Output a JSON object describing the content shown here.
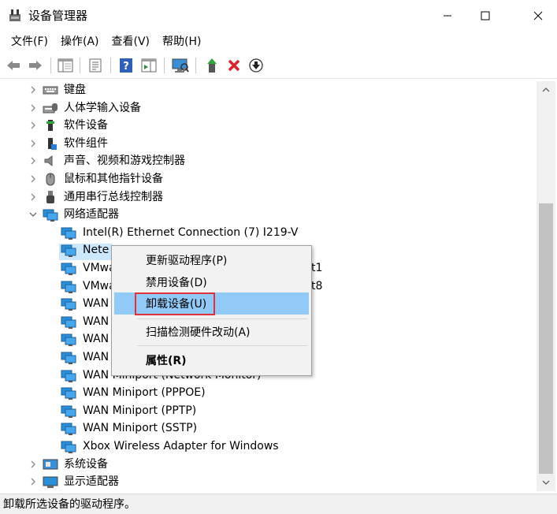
{
  "window": {
    "title": "设备管理器"
  },
  "menu": [
    "文件(F)",
    "操作(A)",
    "查看(V)",
    "帮助(H)"
  ],
  "tree": {
    "categories_top": [
      {
        "label": "键盘",
        "icon": "keyboard-icon"
      },
      {
        "label": "人体学输入设备",
        "icon": "hid-icon"
      },
      {
        "label": "软件设备",
        "icon": "software-device-icon"
      },
      {
        "label": "软件组件",
        "icon": "software-component-icon"
      },
      {
        "label": "声音、视频和游戏控制器",
        "icon": "speaker-icon"
      },
      {
        "label": "鼠标和其他指针设备",
        "icon": "mouse-icon"
      },
      {
        "label": "通用串行总线控制器",
        "icon": "usb-icon"
      }
    ],
    "network_category": {
      "label": "网络适配器",
      "icon": "network-adapter-icon"
    },
    "network_children": [
      "Intel(R) Ethernet Connection (7) I219-V",
      "Nete",
      "VMwa",
      "VMwa",
      "WAN",
      "WAN",
      "WAN",
      "WAN",
      "WAN Miniport (Network Monitor)",
      "WAN Miniport (PPPOE)",
      "WAN Miniport (PPTP)",
      "WAN Miniport (SSTP)",
      "Xbox Wireless Adapter for Windows"
    ],
    "vmware_suffixes": [
      "t1",
      "t8"
    ],
    "categories_bottom": [
      {
        "label": "系统设备",
        "icon": "system-device-icon"
      },
      {
        "label": "显示适配器",
        "icon": "display-adapter-icon"
      }
    ]
  },
  "context_menu": {
    "items": [
      "更新驱动程序(P)",
      "禁用设备(D)",
      "卸载设备(U)",
      "扫描检测硬件改动(A)",
      "属性(R)"
    ],
    "highlighted": "卸载设备(U)"
  },
  "status": {
    "text": "卸载所选设备的驱动程序。"
  },
  "colors": {
    "highlight": "#91c9f7",
    "selection": "#cce8ff",
    "red_outline": "#e0303a",
    "network_icon": "#2b8fd8"
  }
}
